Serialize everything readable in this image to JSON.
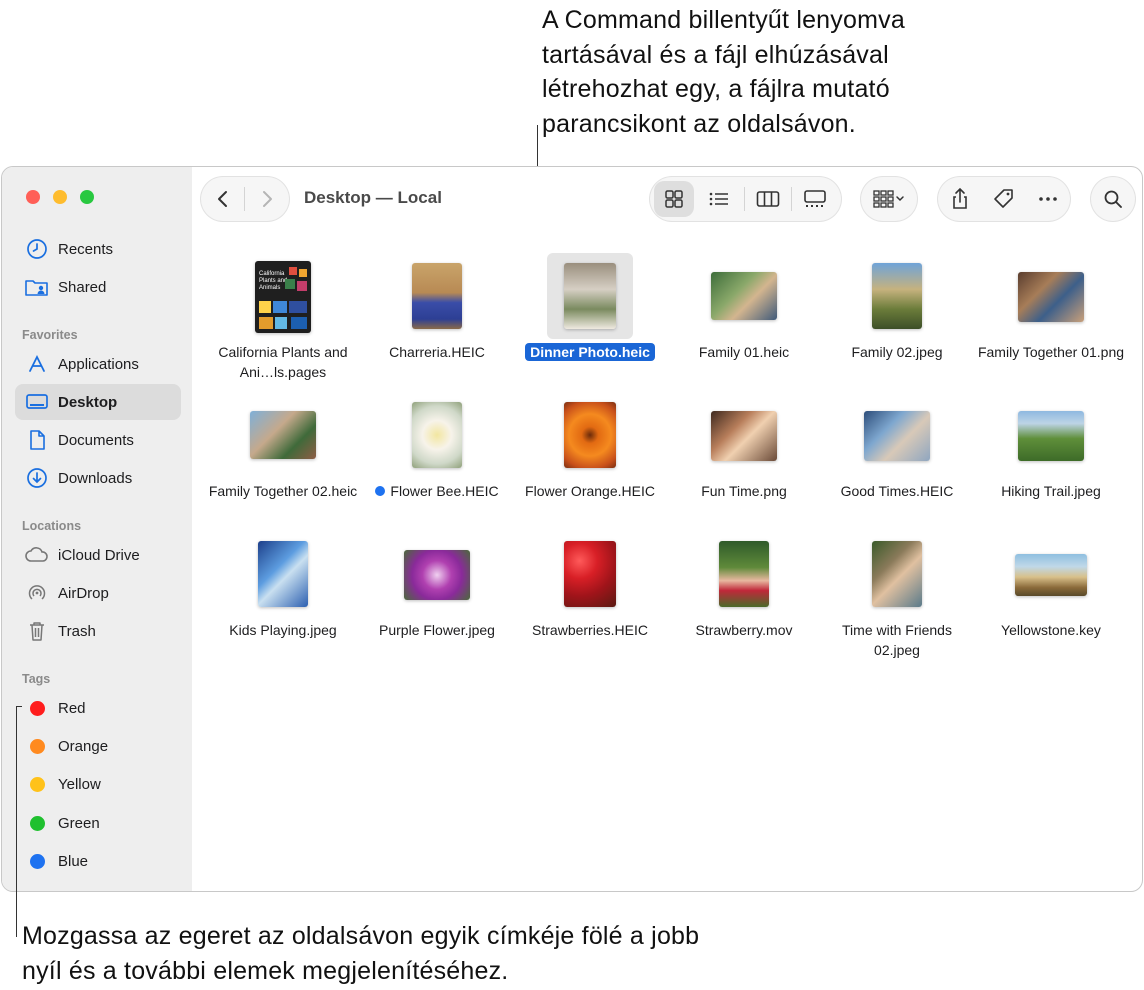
{
  "callouts": {
    "top": "A Command billentyűt lenyomva tartásával és a fájl elhúzásával létrehozhat egy, a fájlra mutató parancsikont az oldalsávon.",
    "bottom": "Mozgassa az egeret az oldalsávon egyik címkéje fölé a jobb nyíl és a további elemek megjelenítéséhez."
  },
  "window": {
    "title": "Desktop — Local"
  },
  "sidebar": {
    "items_top": [
      {
        "label": "Recents",
        "icon": "clock-icon"
      },
      {
        "label": "Shared",
        "icon": "shared-folder-icon"
      }
    ],
    "favorites_label": "Favorites",
    "favorites": [
      {
        "label": "Applications",
        "icon": "applications-icon"
      },
      {
        "label": "Desktop",
        "icon": "desktop-icon",
        "selected": true
      },
      {
        "label": "Documents",
        "icon": "document-icon"
      },
      {
        "label": "Downloads",
        "icon": "download-icon"
      }
    ],
    "locations_label": "Locations",
    "locations": [
      {
        "label": "iCloud Drive",
        "icon": "cloud-icon"
      },
      {
        "label": "AirDrop",
        "icon": "airdrop-icon"
      },
      {
        "label": "Trash",
        "icon": "trash-icon"
      }
    ],
    "tags_label": "Tags",
    "tags": [
      {
        "label": "Red",
        "color": "#ff1d1d"
      },
      {
        "label": "Orange",
        "color": "#ff8a1f"
      },
      {
        "label": "Yellow",
        "color": "#ffc21a"
      },
      {
        "label": "Green",
        "color": "#1fc02f"
      },
      {
        "label": "Blue",
        "color": "#1e72f0"
      }
    ]
  },
  "files": [
    {
      "name": "California Plants and Ani…ls.pages",
      "kind": "pages"
    },
    {
      "name": "Charreria.HEIC",
      "kind": "photo"
    },
    {
      "name": "Dinner Photo.heic",
      "kind": "photo",
      "selected": true
    },
    {
      "name": "Family 01.heic",
      "kind": "photo"
    },
    {
      "name": "Family 02.jpeg",
      "kind": "photo"
    },
    {
      "name": "Family Together 01.png",
      "kind": "photo"
    },
    {
      "name": "Family Together 02.heic",
      "kind": "photo"
    },
    {
      "name": "Flower Bee.HEIC",
      "kind": "photo",
      "tag_color": "#1e72f0"
    },
    {
      "name": "Flower Orange.HEIC",
      "kind": "photo"
    },
    {
      "name": "Fun Time.png",
      "kind": "photo"
    },
    {
      "name": "Good Times.HEIC",
      "kind": "photo"
    },
    {
      "name": "Hiking Trail.jpeg",
      "kind": "photo"
    },
    {
      "name": "Kids Playing.jpeg",
      "kind": "photo"
    },
    {
      "name": "Purple Flower.jpeg",
      "kind": "photo"
    },
    {
      "name": "Strawberries.HEIC",
      "kind": "photo"
    },
    {
      "name": "Strawberry.mov",
      "kind": "video"
    },
    {
      "name": "Time with Friends 02.jpeg",
      "kind": "photo"
    },
    {
      "name": "Yellowstone.key",
      "kind": "keynote"
    }
  ]
}
